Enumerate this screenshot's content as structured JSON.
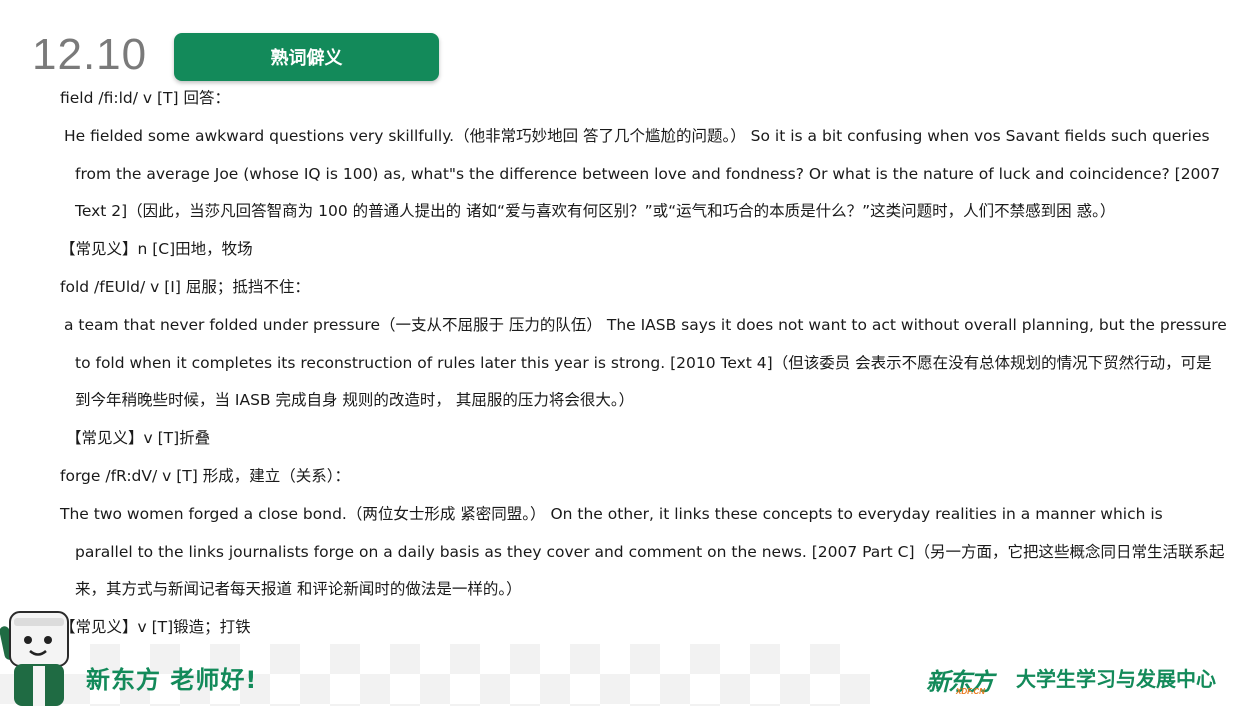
{
  "date": "12.10",
  "title": "熟词僻义",
  "lines": [
    "field /fi:ld/ v [T] 回答：",
    " He fielded some awkward questions very skillfully.（他非常巧妙地回 答了几个尴尬的问题。） So it is a bit confusing when vos Savant fields such queries",
    "from the average Joe (whose IQ is 100) as, what\"s the difference between love and fondness? Or what is the nature of luck and coincidence? [2007",
    "Text 2]（因此，当莎凡回答智商为 100 的普通人提出的 诸如“爱与喜欢有何区别？”或“运气和巧合的本质是什么？”这类问题时，人们不禁感到困 惑。）",
    "【常见义】n [C]田地，牧场",
    "fold /fEUld/ v [I] 屈服；抵挡不住：",
    " a team that never folded under pressure（一支从不屈服于 压力的队伍） The IASB says it does not want to act without overall planning, but the pressure",
    "to fold when it completes its reconstruction of rules later this year is strong. [2010 Text 4]（但该委员 会表示不愿在没有总体规划的情况下贸然行动，可是",
    "到今年稍晚些时候，当 IASB 完成自身 规则的改造时， 其屈服的压力将会很大。）",
    " 【常见义】v [T]折叠",
    "forge /fR:dV/ v [T] 形成，建立（关系）：",
    "The two women forged a close bond.（两位女士形成 紧密同盟。） On the other, it links these concepts to everyday realities in a manner which is",
    "parallel to the links journalists forge on a daily basis as they cover and comment on the news. [2007 Part C]（另一方面，它把这些概念同日常生活联系起",
    "来，其方式与新闻记者每天报道 和评论新闻时的做法是一样的。）",
    "【常见义】v [T]锻造；打铁"
  ],
  "footer": {
    "slogan": "新东方 老师好!",
    "logo_cn": "新东方",
    "logo_en": "XDF.CN",
    "center_name": "大学生学习与发展中心"
  },
  "colors": {
    "brand_green": "#138a5a",
    "logo_orange": "#e87a1e",
    "date_gray": "#7a7a7a"
  },
  "icons": {
    "mascot": "mascot-character-icon"
  }
}
